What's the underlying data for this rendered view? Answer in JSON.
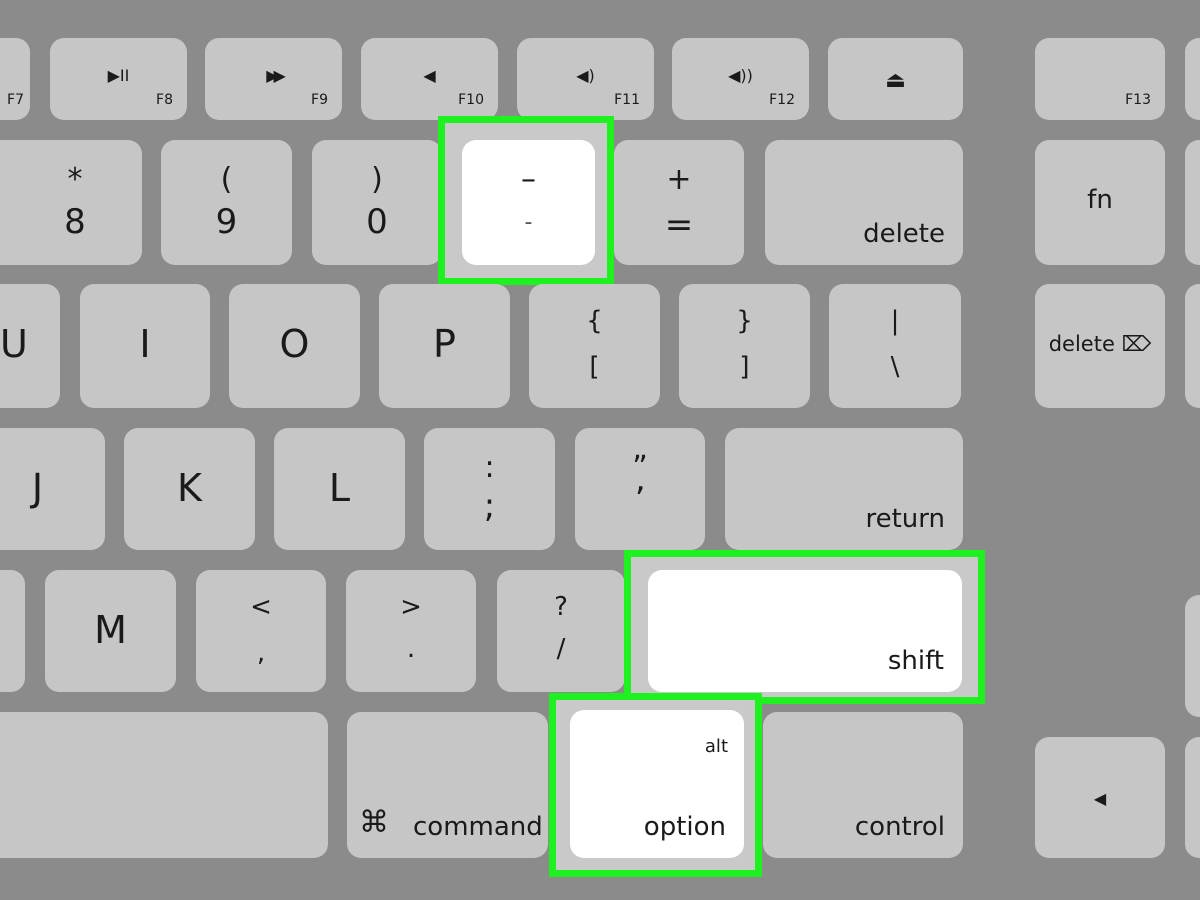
{
  "highlight_color": "#1ff01f",
  "function_row": [
    {
      "label": "F7"
    },
    {
      "label": "F8",
      "icon": "play-pause-icon",
      "glyph": "▶II"
    },
    {
      "label": "F9",
      "icon": "fast-forward-icon",
      "glyph": "▶▶"
    },
    {
      "label": "F10",
      "icon": "mute-icon",
      "glyph": "◀"
    },
    {
      "label": "F11",
      "icon": "volume-down-icon",
      "glyph": "◀)"
    },
    {
      "label": "F12",
      "icon": "volume-up-icon",
      "glyph": "◀))"
    },
    {
      "icon": "eject-icon",
      "glyph": "⏏"
    },
    {
      "label": "F13"
    }
  ],
  "number_row": [
    {
      "top": "*",
      "bottom": "8"
    },
    {
      "top": "(",
      "bottom": "9"
    },
    {
      "top": ")",
      "bottom": "0"
    },
    {
      "top": "–",
      "bottom": "-",
      "highlighted": true
    },
    {
      "top": "+",
      "bottom": "="
    },
    {
      "label": "delete"
    },
    {
      "label": "fn"
    }
  ],
  "letter_row_1": [
    {
      "label": "U"
    },
    {
      "label": "I"
    },
    {
      "label": "O"
    },
    {
      "label": "P"
    },
    {
      "top": "{",
      "bottom": "["
    },
    {
      "top": "}",
      "bottom": "]"
    },
    {
      "top": "|",
      "bottom": "\\"
    },
    {
      "label": "delete",
      "icon": "forward-delete-icon",
      "glyph": "⌦"
    }
  ],
  "letter_row_2": [
    {
      "label": "J"
    },
    {
      "label": "K"
    },
    {
      "label": "L"
    },
    {
      "top": ":",
      "bottom": ";"
    },
    {
      "top": "”",
      "bottom": "’"
    },
    {
      "label": "return"
    }
  ],
  "letter_row_3": [
    {
      "label": "M"
    },
    {
      "top": "<",
      "bottom": ","
    },
    {
      "top": ">",
      "bottom": "."
    },
    {
      "top": "?",
      "bottom": "/"
    },
    {
      "label": "shift",
      "highlighted": true
    }
  ],
  "bottom_row": [
    {
      "label": "command",
      "icon": "command-icon",
      "glyph": "⌘"
    },
    {
      "label": "option",
      "sublabel": "alt",
      "highlighted": true
    },
    {
      "label": "control"
    },
    {
      "icon": "left-arrow-icon",
      "glyph": "◀"
    }
  ]
}
